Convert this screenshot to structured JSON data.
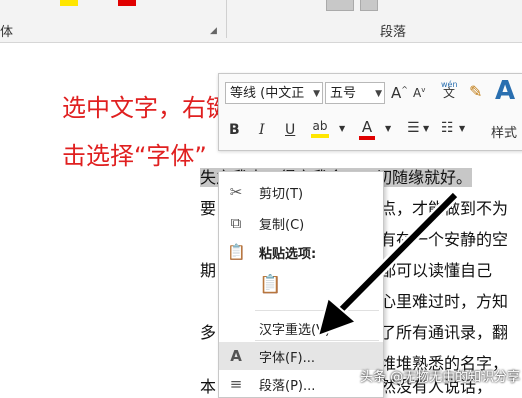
{
  "ribbon": {
    "left_group_label": "体",
    "paragraph_group_label": "段落",
    "swatch_yellow": "#ffe600",
    "swatch_red": "#e00000"
  },
  "instruction": {
    "line1": "选中文字，右键单",
    "line2": "击选择“字体”",
    "color": "#e02020"
  },
  "document": {
    "lines": [
      {
        "text": "失之我幸，得之我命，一切随缘就好。"
      },
      {
        "text": "要",
        "right": "点，才能做到不为"
      },
      {
        "text": "",
        "right": "有在一个安静的空"
      },
      {
        "text": "期",
        "right": "都可以读懂自己"
      },
      {
        "text": "",
        "right": "心里难过时，方知"
      },
      {
        "text": "多",
        "right": "了所有通讯录，翻"
      },
      {
        "text": "",
        "right": "堆堆熟悉的名字，"
      },
      {
        "text": "本",
        "right": "然没有人说话，"
      }
    ]
  },
  "mini_toolbar": {
    "font_name": "等线 (中文正",
    "font_size": "五号",
    "grow_font": "A",
    "shrink_font": "A",
    "pinyin": "wén\n文",
    "bold": "B",
    "italic": "I",
    "underline": "U",
    "highlight": "ab",
    "font_color": "A",
    "styles_label": "样式"
  },
  "context_menu": {
    "items": [
      {
        "label": "剪切(T)",
        "icon": "scissors-icon"
      },
      {
        "label": "复制(C)",
        "icon": "copy-icon"
      },
      {
        "label": "粘贴选项:",
        "icon": "clipboard-icon"
      },
      {
        "label": "",
        "icon": "paste-keep-text-icon"
      },
      {
        "label": "汉字重选(V)",
        "icon": ""
      },
      {
        "label": "字体(F)...",
        "icon": "font-icon"
      },
      {
        "label": "段落(P)...",
        "icon": "paragraph-icon"
      }
    ]
  },
  "watermark": "头条 @无物无由的知识分享"
}
